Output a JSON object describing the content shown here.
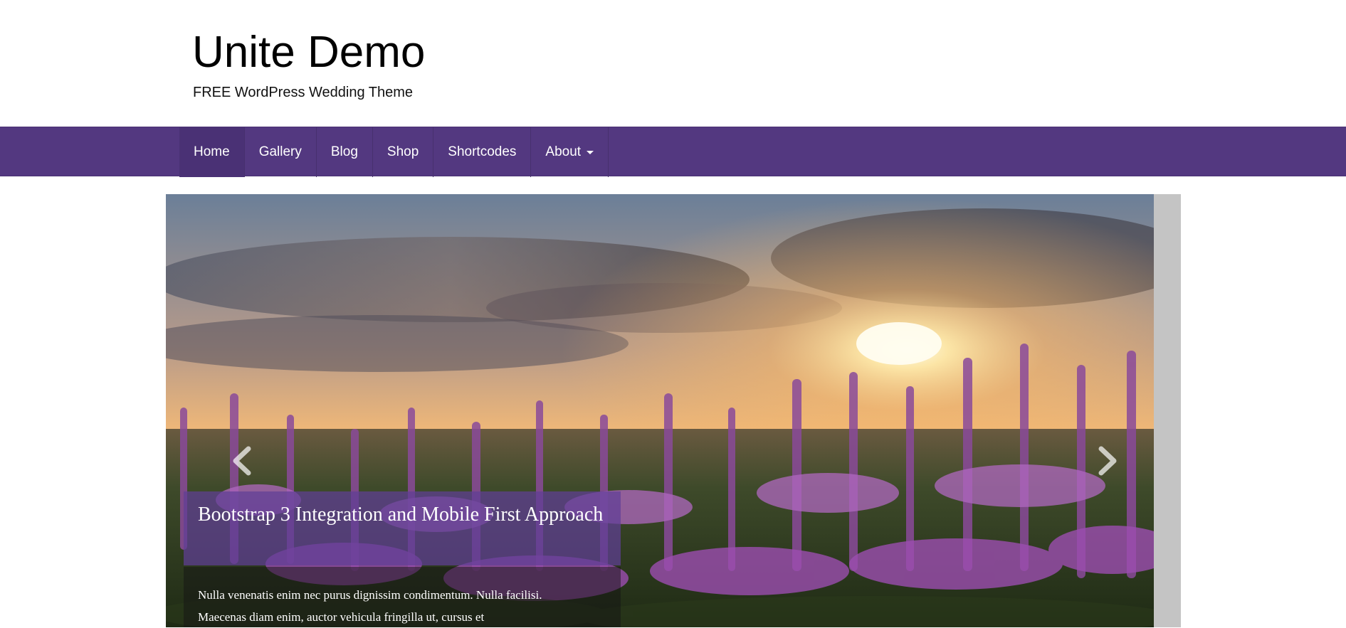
{
  "site": {
    "title": "Unite Demo",
    "tagline": "FREE WordPress Wedding Theme"
  },
  "nav": {
    "items": [
      {
        "label": "Home",
        "active": true
      },
      {
        "label": "Gallery"
      },
      {
        "label": "Blog"
      },
      {
        "label": "Shop"
      },
      {
        "label": "Shortcodes"
      },
      {
        "label": "About",
        "has_dropdown": true
      }
    ]
  },
  "slider": {
    "image_description": "lavender-field-sunset",
    "caption_title": "Bootstrap 3 Integration and Mobile First Approach",
    "caption_text": "Nulla venenatis enim nec purus dignissim condimentum. Nulla facilisi. Maecenas diam enim, auctor vehicula fringilla ut, cursus et",
    "prev_icon": "chevron-left-icon",
    "next_icon": "chevron-right-icon"
  },
  "colors": {
    "nav_background": "#533880",
    "nav_active": "#4a3175",
    "caption_overlay": "#603e96",
    "page_background": "#ffffff"
  }
}
